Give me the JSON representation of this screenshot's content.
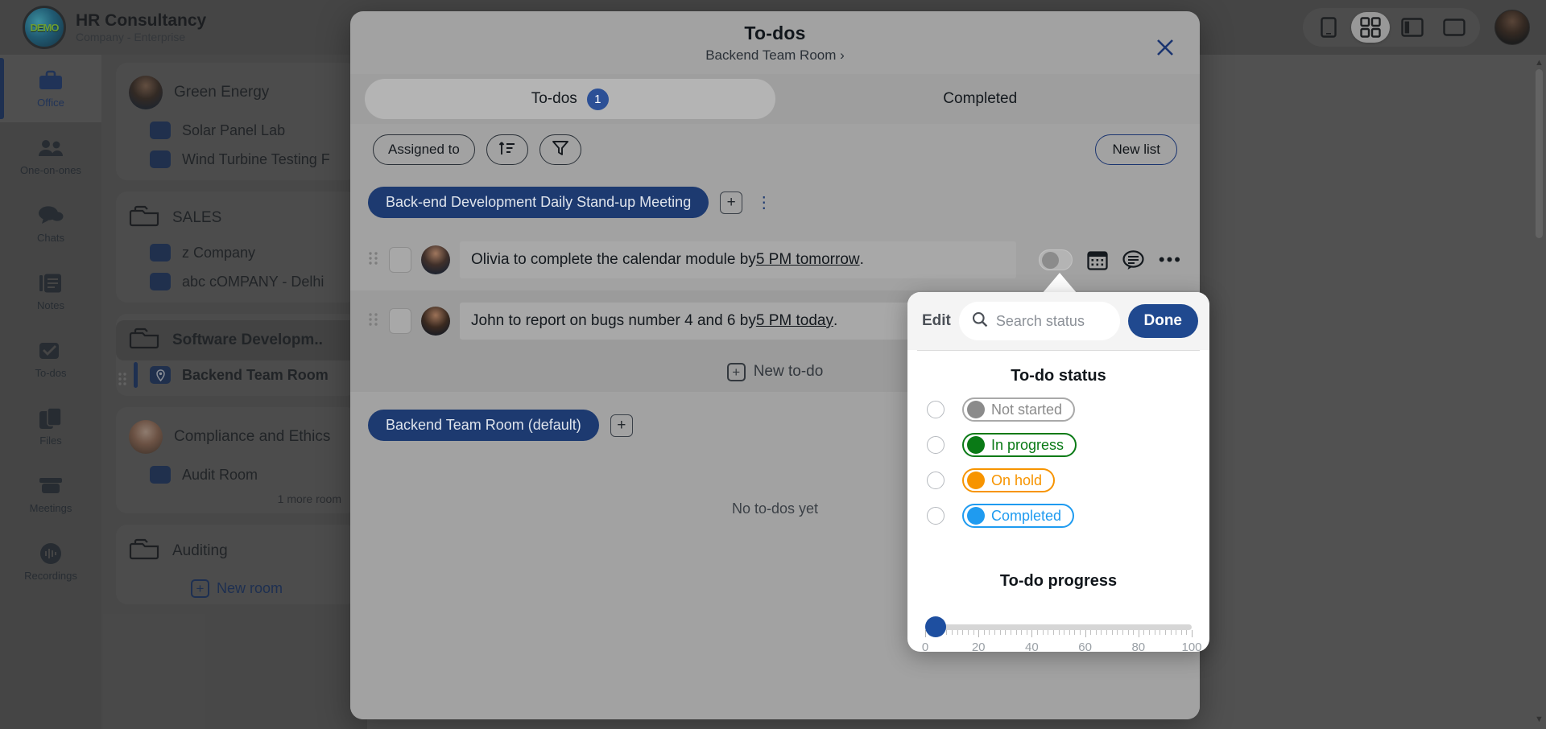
{
  "brand": {
    "logo_text": "DEMO",
    "title": "HR Consultancy",
    "subtitle": "Company - Enterprise"
  },
  "topbar": {
    "view_buttons": [
      {
        "name": "mobile-view-icon",
        "label": "Mobile view",
        "active": false
      },
      {
        "name": "grid-view-icon",
        "label": "Grid view",
        "active": true
      },
      {
        "name": "split-view-icon",
        "label": "Split view",
        "active": false
      },
      {
        "name": "full-view-icon",
        "label": "Full view",
        "active": false
      }
    ],
    "avatar_label": "User avatar"
  },
  "rail": {
    "items": [
      {
        "icon": "briefcase-icon",
        "label": "Office",
        "active": true
      },
      {
        "icon": "people-icon",
        "label": "One-on-ones",
        "active": false
      },
      {
        "icon": "chat-bubbles-icon",
        "label": "Chats",
        "active": false
      },
      {
        "icon": "notes-icon",
        "label": "Notes",
        "active": false
      },
      {
        "icon": "checkbox-icon",
        "label": "To-dos",
        "active": false
      },
      {
        "icon": "files-icon",
        "label": "Files",
        "active": false
      },
      {
        "icon": "meetings-icon",
        "label": "Meetings",
        "active": false
      },
      {
        "icon": "recordings-icon",
        "label": "Recordings",
        "active": false
      }
    ]
  },
  "rooms": {
    "groups": [
      {
        "name": "Green Energy",
        "icon": "avatar",
        "selected": false,
        "rooms": [
          {
            "label": "Solar Panel Lab",
            "selected": false
          },
          {
            "label": "Wind Turbine Testing F",
            "selected": false
          }
        ]
      },
      {
        "name": "SALES",
        "icon": "folder",
        "selected": false,
        "rooms": [
          {
            "label": "z Company",
            "selected": false
          },
          {
            "label": "abc cOMPANY - Delhi",
            "selected": false
          }
        ]
      },
      {
        "name": "Software Developm..",
        "icon": "folder",
        "selected": true,
        "rooms": [
          {
            "label": "Backend Team Room",
            "selected": true
          }
        ]
      },
      {
        "name": "Compliance and Ethics",
        "icon": "avatar",
        "selected": false,
        "rooms": [
          {
            "label": "Audit Room",
            "selected": false
          }
        ],
        "more_label": "1 more room"
      },
      {
        "name": "Auditing",
        "icon": "folder",
        "selected": false,
        "rooms": []
      }
    ],
    "new_room_label": "New room"
  },
  "modal": {
    "title": "To-dos",
    "breadcrumb": "Backend Team Room ›",
    "close_label": "✕",
    "tabs": [
      {
        "label": "To-dos",
        "badge": "1",
        "active": true
      },
      {
        "label": "Completed",
        "badge": "",
        "active": false
      }
    ],
    "toolbar": {
      "assigned_to_label": "Assigned to",
      "sort_icon": "sort-ascending-icon",
      "filter_icon": "filter-funnel-icon",
      "new_list_label": "New list"
    },
    "lists": [
      {
        "name": "Back-end Development Daily Stand-up Meeting",
        "add_label": "+",
        "menu_label": "⋮",
        "todos": [
          {
            "text_before": "Olivia to complete the calendar module by ",
            "text_link": "5 PM tomorrow",
            "text_after": ".",
            "assignee": "Olivia",
            "status": "Not started"
          },
          {
            "text_before": "John to report on bugs number 4 and 6 by ",
            "text_link": "5 PM today",
            "text_after": ".",
            "assignee": "John",
            "status": "Not started"
          }
        ],
        "new_todo_label": "New to-do"
      },
      {
        "name": "Backend Team Room (default)",
        "add_label": "+",
        "todos": [],
        "empty_label": "No to-dos yet"
      }
    ]
  },
  "status_popover": {
    "edit_label": "Edit",
    "search_placeholder": "Search status",
    "search_value": "",
    "done_label": "Done",
    "status_section_title": "To-do status",
    "statuses": [
      {
        "label": "Not started",
        "color": "#8b8b8b",
        "text_color": "#8b8b8b",
        "selected": false
      },
      {
        "label": "In progress",
        "color": "#0a7a16",
        "text_color": "#0a7a16",
        "selected": false
      },
      {
        "label": "On hold",
        "color": "#f79400",
        "text_color": "#f79400",
        "selected": false
      },
      {
        "label": "Completed",
        "color": "#1f9bf0",
        "text_color": "#1f9bf0",
        "selected": false
      }
    ],
    "progress_section_title": "To-do progress",
    "progress_value": 0,
    "progress_min": 0,
    "progress_max": 100,
    "progress_ticks": [
      "0",
      "20",
      "40",
      "60",
      "80",
      "100"
    ]
  }
}
